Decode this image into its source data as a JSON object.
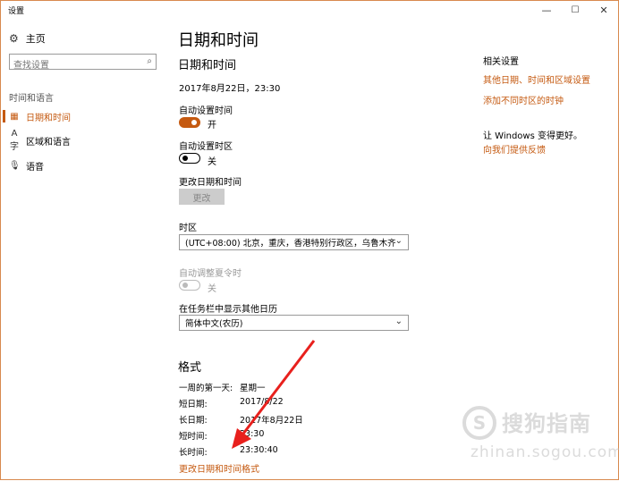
{
  "window": {
    "title": "设置",
    "minimize_glyph": "—",
    "maximize_glyph": "☐",
    "close_glyph": "✕"
  },
  "sidebar": {
    "home_label": "主页",
    "home_icon": "gear-icon",
    "search_placeholder": "查找设置",
    "section_label": "时间和语言",
    "items": [
      {
        "label": "日期和时间",
        "icon": "calendar-clock-icon",
        "selected": true
      },
      {
        "label": "区域和语言",
        "icon": "region-language-icon",
        "selected": false
      },
      {
        "label": "语音",
        "icon": "microphone-icon",
        "selected": false
      }
    ]
  },
  "main": {
    "page_title": "日期和时间",
    "section_title": "日期和时间",
    "current_datetime": "2017年8月22日，23:30",
    "auto_time": {
      "label": "自动设置时间",
      "state_text": "开",
      "on": true
    },
    "auto_timezone": {
      "label": "自动设置时区",
      "state_text": "关",
      "on": false
    },
    "change_datetime": {
      "label": "更改日期和时间",
      "button": "更改"
    },
    "timezone": {
      "label": "时区",
      "value": "(UTC+08:00) 北京，重庆，香港特别行政区，乌鲁木齐"
    },
    "dst": {
      "label": "自动调整夏令时",
      "state_text": "关"
    },
    "extra_calendar": {
      "label": "在任务栏中显示其他日历",
      "value": "简体中文(农历)"
    },
    "format": {
      "title": "格式",
      "rows": [
        {
          "label": "一周的第一天:",
          "value": "星期一"
        },
        {
          "label": "短日期:",
          "value": "2017/8/22"
        },
        {
          "label": "长日期:",
          "value": "2017年8月22日"
        },
        {
          "label": "短时间:",
          "value": "23:30"
        },
        {
          "label": "长时间:",
          "value": "23:30:40"
        }
      ],
      "change_link": "更改日期和时间格式"
    }
  },
  "related": {
    "title": "相关设置",
    "links": [
      "其他日期、时间和区域设置",
      "添加不同时区的时钟"
    ],
    "better_title": "让 Windows 变得更好。",
    "feedback_link": "向我们提供反馈"
  },
  "watermark": {
    "text": "搜狗指南",
    "url": "zhinan.sogou.com"
  },
  "colors": {
    "accent": "#c55a11",
    "window_border": "#d8894e",
    "arrow": "#e8201d"
  }
}
